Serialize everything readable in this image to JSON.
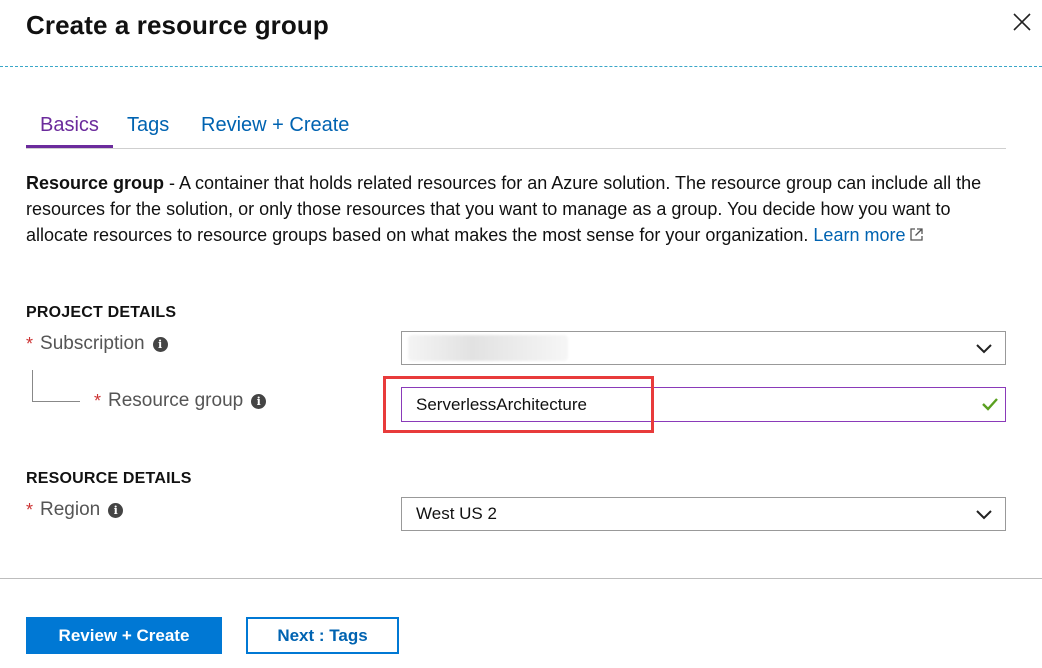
{
  "header": {
    "title": "Create a resource group"
  },
  "tabs": [
    {
      "label": "Basics",
      "active": true
    },
    {
      "label": "Tags",
      "active": false
    },
    {
      "label": "Review + Create",
      "active": false
    }
  ],
  "description": {
    "lead": "Resource group",
    "text": " - A container that holds related resources for an Azure solution. The resource group can include all the resources for the solution, or only those resources that you want to manage as a group. You decide how you want to allocate resources to resource groups based on what makes the most sense for your organization. ",
    "link": "Learn more"
  },
  "project_details": {
    "heading": "PROJECT DETAILS",
    "subscription": {
      "required_mark": "*",
      "label": "Subscription",
      "value": ""
    },
    "resource_group": {
      "required_mark": "*",
      "label": "Resource group",
      "value": "ServerlessArchitecture"
    }
  },
  "resource_details": {
    "heading": "RESOURCE DETAILS",
    "region": {
      "required_mark": "*",
      "label": "Region",
      "value": "West US 2"
    }
  },
  "footer": {
    "primary_label": "Review + Create",
    "secondary_label": "Next : Tags"
  },
  "colors": {
    "accent_blue": "#0078d4",
    "tab_active": "#6b2b9c",
    "highlight": "#e83b3b",
    "valid_check": "#5aa020"
  },
  "icons": [
    "close-icon",
    "external-link-icon",
    "info-icon",
    "chevron-down-icon",
    "checkmark-icon"
  ]
}
